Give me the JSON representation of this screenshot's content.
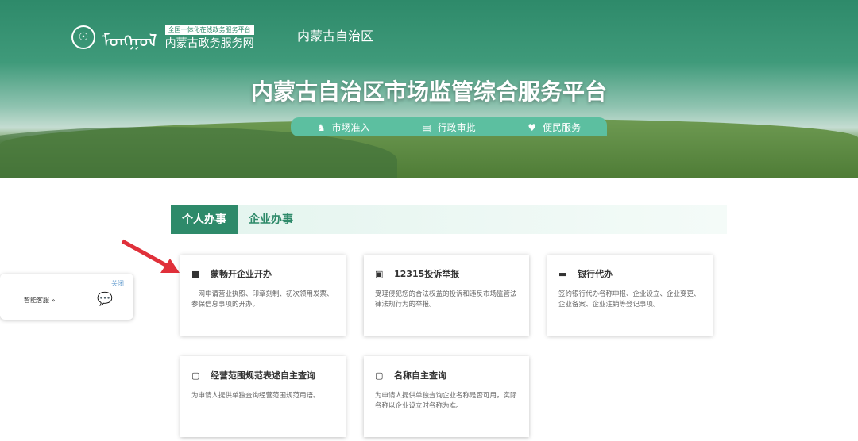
{
  "header": {
    "tagline": "全国一体化在线政务服务平台",
    "site_name": "内蒙古政务服务网",
    "mongol_script": "ᠮᠣᠩᠭᠣᠯ",
    "region": "内蒙古自治区",
    "title": "内蒙古自治区市场监管综合服务平台"
  },
  "nav": [
    {
      "label": "市场准入",
      "icon": "market-icon"
    },
    {
      "label": "行政审批",
      "icon": "approval-icon"
    },
    {
      "label": "便民服务",
      "icon": "heart-hand-icon"
    }
  ],
  "tabs": [
    {
      "label": "个人办事",
      "active": true
    },
    {
      "label": "企业办事",
      "active": false
    }
  ],
  "cards": [
    {
      "title": "蒙畅开企业开办",
      "desc": "一网申请营业执照、印章刻制、初次领用发票、参保信息事项的开办。",
      "icon": "briefcase-icon"
    },
    {
      "title": "12315投诉举报",
      "desc": "受理侵犯您的合法权益的投诉和违反市场监管法律法规行为的举报。",
      "icon": "complaint-icon"
    },
    {
      "title": "银行代办",
      "desc": "签约银行代办名称申报、企业设立、企业变更、企业备案、企业注销等登记事项。",
      "icon": "bank-card-icon"
    },
    {
      "title": "经营范围规范表述自主查询",
      "desc": "为申请人提供单独查询经营范围规范用语。",
      "icon": "document-search-icon"
    },
    {
      "title": "名称自主查询",
      "desc": "为申请人提供单独查询企业名称是否可用，实际名称以企业设立时名称为准。",
      "icon": "name-search-icon"
    }
  ],
  "chat_widget": {
    "close": "关闭",
    "label": "智能客服 »"
  },
  "colors": {
    "primary": "#2e8a6a",
    "nav": "#5cbfa0",
    "arrow": "#e0303a"
  }
}
